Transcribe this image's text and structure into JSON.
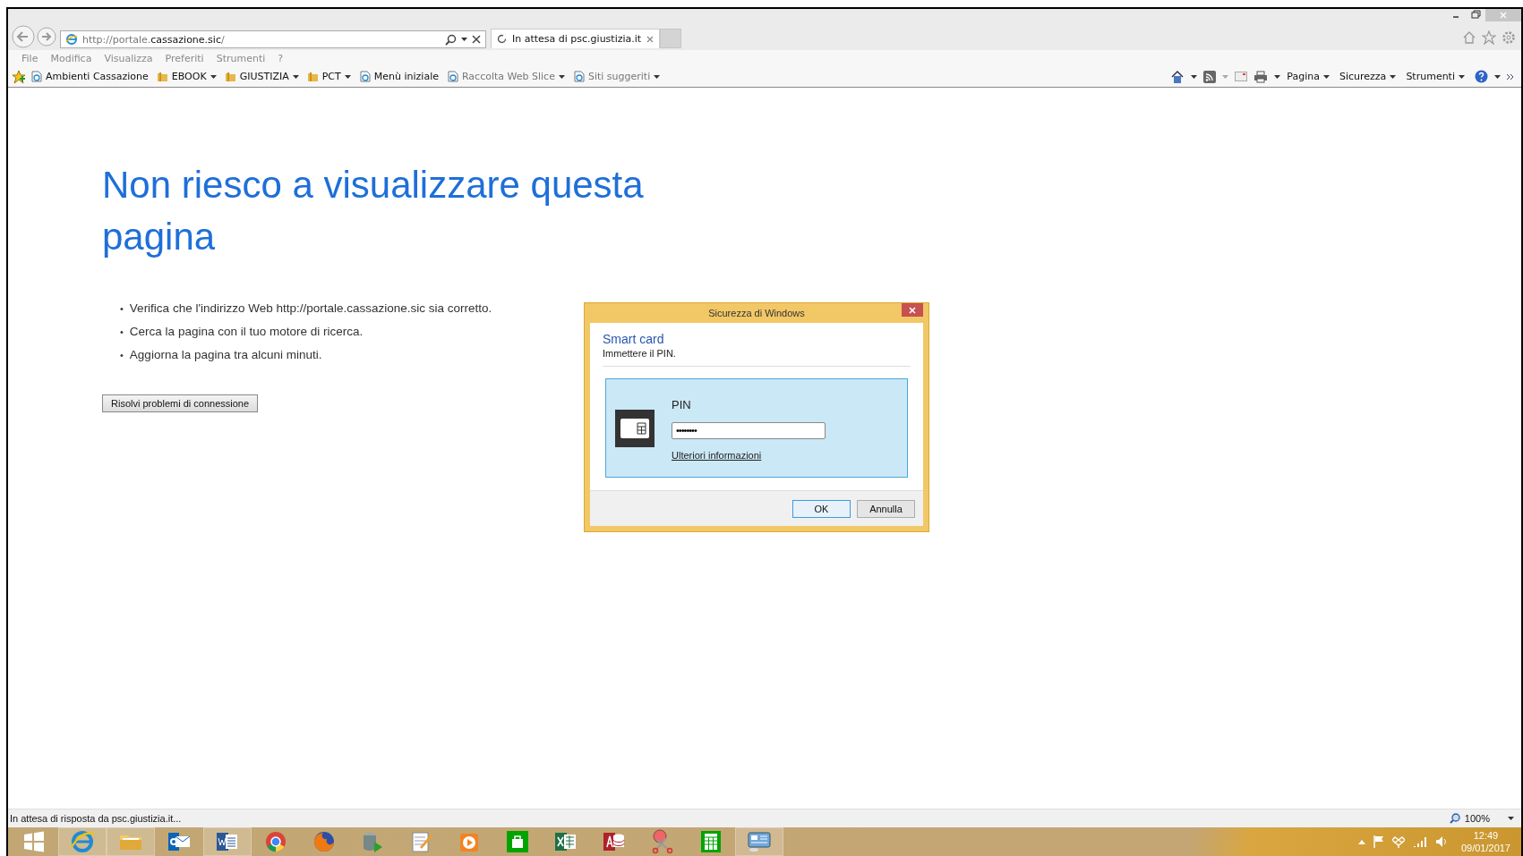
{
  "address_bar": {
    "url_prefix": "http://portale.",
    "url_domain": "cassazione.sic",
    "url_suffix": "/"
  },
  "tabs": [
    {
      "label": "In attesa di psc.giustizia.it",
      "selected": true
    }
  ],
  "menu_bar": [
    "File",
    "Modifica",
    "Visualizza",
    "Preferiti",
    "Strumenti",
    "?"
  ],
  "favorites_bar": [
    {
      "label": "Ambienti Cassazione",
      "kind": "page",
      "dropdown": false,
      "disabled": false
    },
    {
      "label": "EBOOK",
      "kind": "folder",
      "dropdown": true,
      "disabled": false
    },
    {
      "label": "GIUSTIZIA",
      "kind": "folder",
      "dropdown": true,
      "disabled": false
    },
    {
      "label": "PCT",
      "kind": "folder",
      "dropdown": true,
      "disabled": false
    },
    {
      "label": "Menù iniziale",
      "kind": "page",
      "dropdown": false,
      "disabled": false
    },
    {
      "label": "Raccolta Web Slice",
      "kind": "page",
      "dropdown": true,
      "disabled": true
    },
    {
      "label": "Siti suggeriti",
      "kind": "page",
      "dropdown": true,
      "disabled": true
    }
  ],
  "command_bar": [
    "Pagina",
    "Sicurezza",
    "Strumenti"
  ],
  "page": {
    "heading": "Non riesco a visualizzare questa pagina",
    "suggestions": [
      {
        "marker": "•",
        "text": "Verifica che l'indirizzo Web http://portale.cassazione.sic sia corretto."
      },
      {
        "marker": "•",
        "text": "Cerca la pagina con il tuo motore di ricerca."
      },
      {
        "marker": "•",
        "text": "Aggiorna la pagina tra alcuni minuti."
      }
    ],
    "button": "Risolvi problemi di connessione"
  },
  "dialog": {
    "title": "Sicurezza di Windows",
    "heading": "Smart card",
    "instruction": "Immettere il PIN.",
    "field_label": "PIN",
    "pin_value": "••••••••",
    "link": "Ulteriori informazioni",
    "buttons": [
      {
        "label": "OK",
        "default": true
      },
      {
        "label": "Annulla",
        "default": false
      }
    ]
  },
  "status_bar": {
    "text": "In attesa di risposta da psc.giustizia.it...",
    "zoom": "100%"
  },
  "taskbar": {
    "apps": [
      {
        "kind": "start",
        "highlighted": false
      },
      {
        "kind": "browser",
        "highlighted": true
      },
      {
        "kind": "folder",
        "highlighted": true
      },
      {
        "kind": "mail",
        "highlighted": false
      },
      {
        "kind": "document",
        "highlighted": true
      },
      {
        "kind": "ring",
        "highlighted": false
      },
      {
        "kind": "sphere",
        "highlighted": false
      },
      {
        "kind": "database",
        "highlighted": false
      },
      {
        "kind": "notepad",
        "highlighted": false
      },
      {
        "kind": "media",
        "highlighted": false
      },
      {
        "kind": "store",
        "highlighted": false
      },
      {
        "kind": "spreadsheet",
        "highlighted": false
      },
      {
        "kind": "access",
        "highlighted": false
      },
      {
        "kind": "scissors",
        "highlighted": false
      },
      {
        "kind": "calculator",
        "highlighted": false
      },
      {
        "kind": "monitor",
        "highlighted": true
      }
    ],
    "time": "12:49",
    "date": "09/01/2017"
  }
}
